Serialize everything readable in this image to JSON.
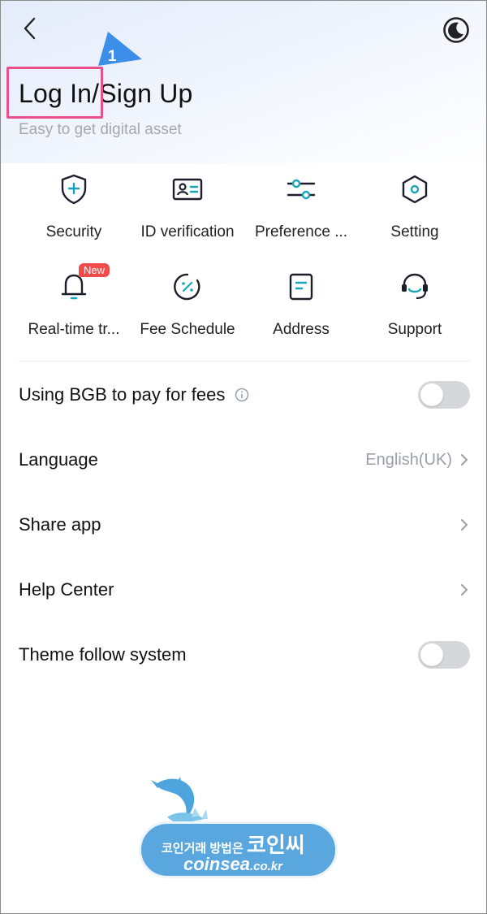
{
  "header": {
    "title": "Log In/Sign Up",
    "subtitle": "Easy to get digital asset",
    "callout_number": "1"
  },
  "shortcuts": [
    {
      "label": "Security",
      "icon": "shield-plus-icon"
    },
    {
      "label": "ID verification",
      "icon": "id-card-icon"
    },
    {
      "label": "Preference ...",
      "icon": "sliders-icon"
    },
    {
      "label": "Setting",
      "icon": "hexagon-gear-icon"
    },
    {
      "label": "Real-time tr...",
      "icon": "bell-icon",
      "badge": "New"
    },
    {
      "label": "Fee Schedule",
      "icon": "percent-icon"
    },
    {
      "label": "Address",
      "icon": "document-icon"
    },
    {
      "label": "Support",
      "icon": "headset-icon"
    }
  ],
  "settings": {
    "bgb_fees": {
      "label": "Using BGB to pay for fees",
      "enabled": false
    },
    "language": {
      "label": "Language",
      "value": "English(UK)"
    },
    "share_app": {
      "label": "Share app"
    },
    "help_center": {
      "label": "Help Center"
    },
    "theme_follow": {
      "label": "Theme follow system",
      "enabled": false
    }
  },
  "watermark": {
    "line1_small": "코인거래 방법은",
    "line1_big": "코인씨",
    "line2_main": "coinsea",
    "line2_suffix": ".co.kr"
  },
  "colors": {
    "accent": "#17a6b8",
    "highlight": "#ea4f8a",
    "callout": "#3d8ee8",
    "badge": "#f04c4c",
    "toggle_off": "#d5d7db"
  }
}
